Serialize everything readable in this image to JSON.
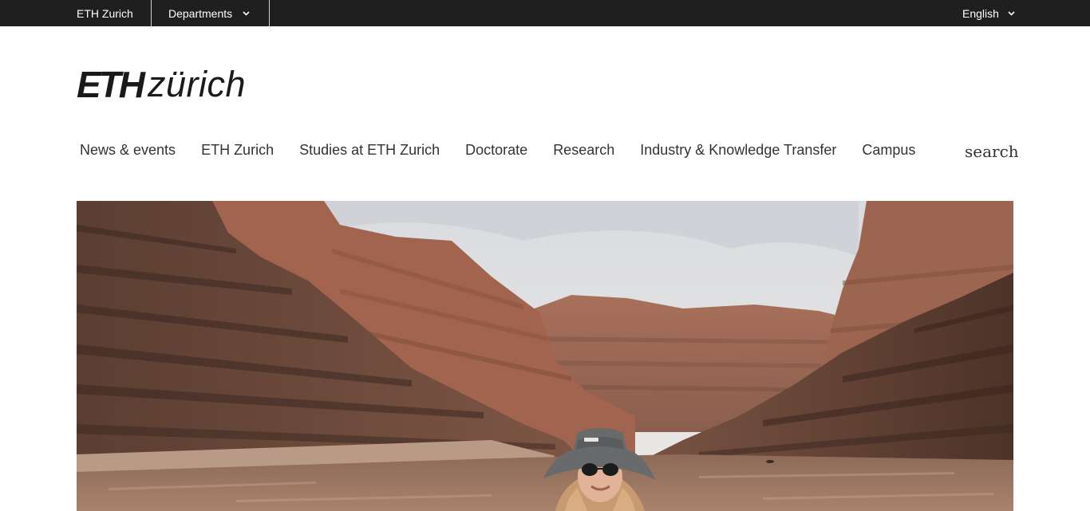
{
  "topbar": {
    "home_label": "ETH Zurich",
    "departments_label": "Departments",
    "departments_icon": "chevron-down-icon",
    "language_label": "English",
    "language_icon": "chevron-down-icon"
  },
  "logo": {
    "brand_bold": "ETH",
    "brand_light": "zürich"
  },
  "nav": {
    "items": [
      "News & events",
      "ETH Zurich",
      "Studies at ETH Zurich",
      "Doctorate",
      "Research",
      "Industry & Knowledge Transfer",
      "Campus"
    ],
    "search_label": "search"
  },
  "hero": {
    "subject": "person in bucket hat and sunglasses on a river in a red rock canyon"
  },
  "colors": {
    "topbar_bg": "#1f1f1f",
    "topbar_text": "#ffffff",
    "nav_text": "#333333",
    "page_bg": "#ffffff"
  }
}
